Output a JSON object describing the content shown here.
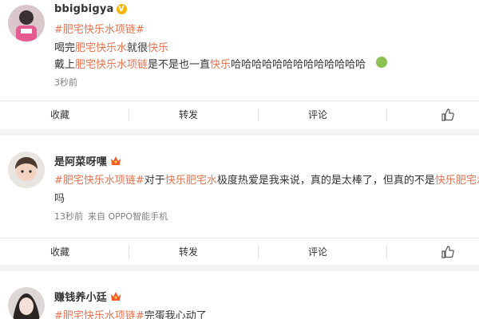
{
  "posts": [
    {
      "user": "bbigbigya",
      "lines": [
        [
          {
            "t": "#肥宅快乐水项链#",
            "hl": true
          }
        ],
        [
          {
            "t": "喝完",
            "hl": false
          },
          {
            "t": "肥宅快乐水",
            "hl": true
          },
          {
            "t": "就很",
            "hl": false
          },
          {
            "t": "快乐",
            "hl": true
          }
        ],
        [
          {
            "t": "戴上",
            "hl": false
          },
          {
            "t": "肥宅快乐水项链",
            "hl": true
          },
          {
            "t": "是不是也一直",
            "hl": false
          },
          {
            "t": "快乐",
            "hl": true
          },
          {
            "t": "哈哈哈哈哈哈哈哈哈哈哈哈哈",
            "hl": false
          }
        ]
      ],
      "time": "3秒前",
      "source": ""
    },
    {
      "user": "是阿菜呀嘿",
      "lines": [
        [
          {
            "t": "#肥宅快乐水项链#",
            "hl": true
          },
          {
            "t": "对于",
            "hl": false
          },
          {
            "t": "快乐肥宅水",
            "hl": true
          },
          {
            "t": "极度热爱是我来说，真的是太棒了，但真的不是",
            "hl": false
          },
          {
            "t": "快乐肥宅水",
            "hl": true
          }
        ],
        [
          {
            "t": "吗",
            "hl": false
          }
        ]
      ],
      "time": "13秒前",
      "source": "来自 OPPO智能手机"
    },
    {
      "user": "赚钱养小廷",
      "lines": [
        [
          {
            "t": "#肥宅快乐水项链#",
            "hl": true
          },
          {
            "t": "完蛋我心动了",
            "hl": false
          }
        ]
      ],
      "time": "",
      "source": ""
    }
  ],
  "actions": {
    "collect": "收藏",
    "repost": "转发",
    "comment": "评论"
  },
  "colors": {
    "highlight": "#eb7350",
    "text": "#333333",
    "meta": "#808080",
    "divider": "#e6e6e6"
  },
  "icons": {
    "verified": "v-badge-icon",
    "member": "crown-icon",
    "like": "thumbs-up-icon",
    "emoji": "green-face-emoji-icon"
  }
}
